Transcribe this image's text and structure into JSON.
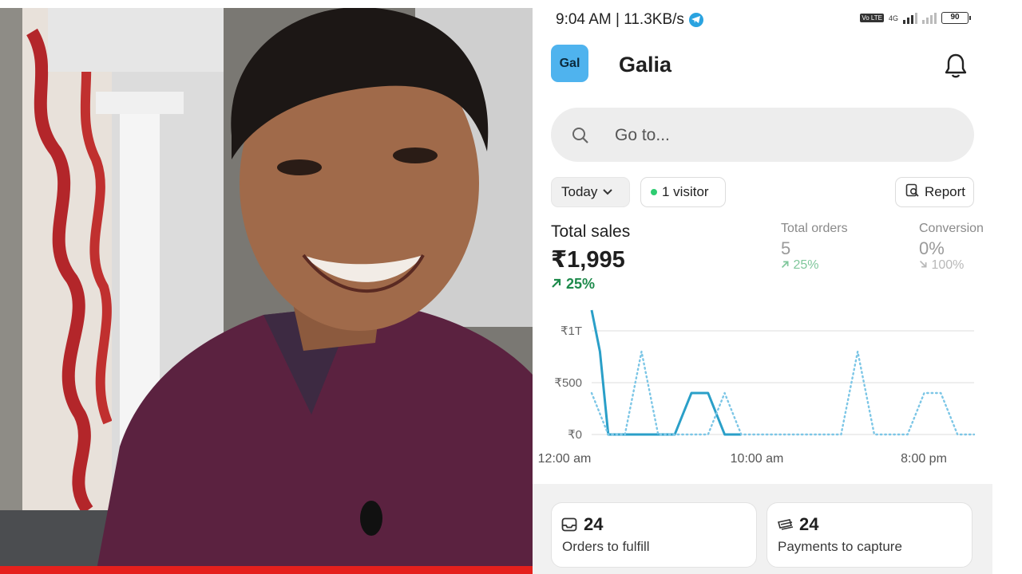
{
  "status_bar": {
    "time_speed": "9:04 AM | 11.3KB/s",
    "network": "4G",
    "volte": "Vo LTE",
    "battery": "90"
  },
  "header": {
    "logo_text": "Gal",
    "store_name": "Galia"
  },
  "search": {
    "placeholder": "Go to..."
  },
  "filters": {
    "date_range": "Today",
    "visitors": "1 visitor",
    "report": "Report"
  },
  "metrics": {
    "total_sales": {
      "label": "Total sales",
      "value": "₹1,995",
      "change": "25%"
    },
    "total_orders": {
      "label": "Total orders",
      "value": "5",
      "change": "25%"
    },
    "conversion": {
      "label": "Conversion",
      "value": "0%",
      "change": "100%"
    }
  },
  "chart_data": {
    "type": "line",
    "y_tick_labels": [
      "₹0",
      "₹500",
      "₹1T"
    ],
    "x_tick_labels": [
      "12:00 am",
      "10:00 am",
      "8:00 pm"
    ],
    "ylim": [
      0,
      1200
    ],
    "x_hours": [
      0,
      23
    ],
    "grid": true,
    "series": [
      {
        "style": "solid",
        "color": "#2a9fc8",
        "x": [
          0,
          0.5,
          1,
          2,
          3,
          4,
          5,
          5.5,
          6,
          6.5,
          7,
          7.5,
          8,
          8.5,
          9
        ],
        "y": [
          1200,
          800,
          0,
          0,
          0,
          0,
          0,
          200,
          400,
          400,
          400,
          200,
          0,
          0,
          0
        ]
      },
      {
        "style": "dotted",
        "color": "#7cc6e6",
        "x": [
          0,
          1,
          2,
          2.5,
          3,
          3.5,
          4,
          5,
          6,
          7,
          7.5,
          8,
          8.5,
          9,
          10,
          12,
          14,
          15,
          15.5,
          16,
          16.5,
          17,
          18,
          19,
          19.5,
          20,
          21,
          21.5,
          22,
          23
        ],
        "y": [
          400,
          0,
          0,
          400,
          800,
          400,
          0,
          0,
          0,
          0,
          200,
          400,
          200,
          0,
          0,
          0,
          0,
          0,
          400,
          800,
          400,
          0,
          0,
          0,
          200,
          400,
          400,
          200,
          0,
          0
        ]
      }
    ]
  },
  "cards": [
    {
      "count": "24",
      "label": "Orders to fulfill"
    },
    {
      "count": "24",
      "label": "Payments to capture"
    }
  ],
  "colors": {
    "accent_logo": "#4fb3ee",
    "positive": "#1d8a4b",
    "chart_solid": "#2a9fc8",
    "chart_dotted": "#7cc6e6",
    "recording_bar": "#e5201c"
  },
  "icons": {
    "status": "telegram-icon",
    "header": "bell-icon",
    "search": "search-icon",
    "today": "chevron-down-icon",
    "visitor": "live-dot-icon",
    "report": "report-search-icon",
    "card_fulfill": "inbox-icon",
    "card_capture": "payment-icon"
  }
}
